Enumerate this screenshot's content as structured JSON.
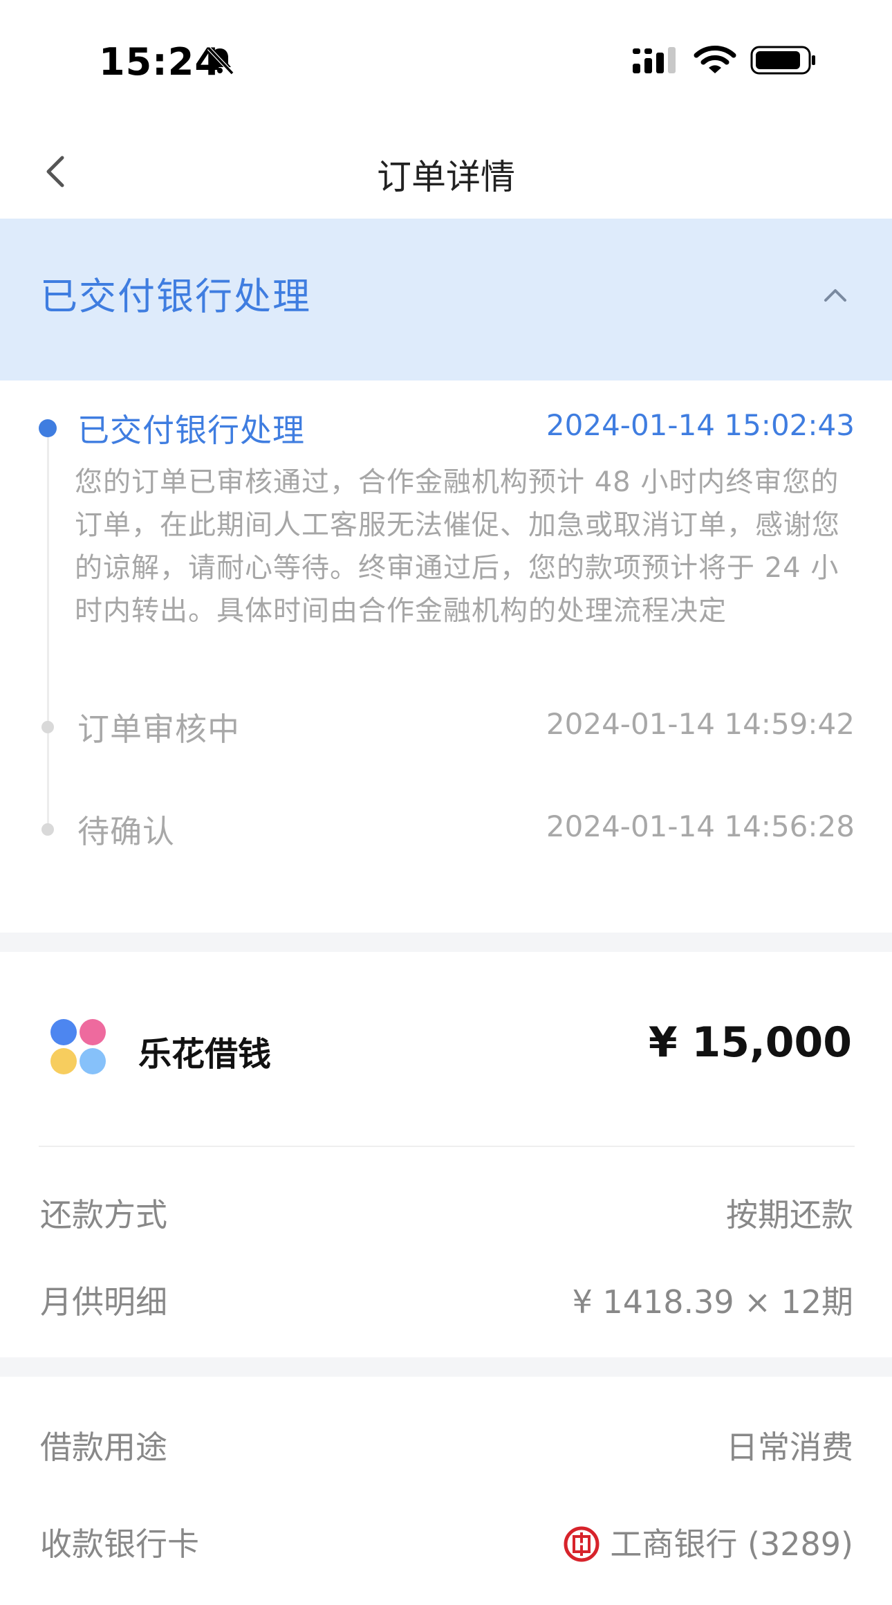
{
  "status_bar": {
    "time": "15:24",
    "icons": [
      "bell-slash-icon",
      "signal-icon",
      "wifi-icon",
      "battery-icon"
    ]
  },
  "nav": {
    "title": "订单详情",
    "back_icon": "chevron-left-icon"
  },
  "banner": {
    "title": "已交付银行处理",
    "toggle_icon": "chevron-up-icon"
  },
  "timeline": [
    {
      "label": "已交付银行处理",
      "time": "2024-01-14 15:02:43",
      "description": "您的订单已审核通过，合作金融机构预计 48 小时内终审您的订单，在此期间人工客服无法催促、加急或取消订单，感谢您的谅解，请耐心等待。终审通过后，您的款项预计将于 24 小时内转出。具体时间由合作金融机构的处理流程决定"
    },
    {
      "label": "订单审核中",
      "time": "2024-01-14 14:59:42"
    },
    {
      "label": "待确认",
      "time": "2024-01-14 14:56:28"
    }
  ],
  "loan": {
    "product_name": "乐花借钱",
    "amount": "¥ 15,000",
    "rows": [
      {
        "label": "还款方式",
        "value": "按期还款"
      },
      {
        "label": "月供明细",
        "value": "¥ 1418.39 × 12期"
      }
    ]
  },
  "details": [
    {
      "label": "借款用途",
      "value": "日常消费"
    },
    {
      "label": "收款银行卡",
      "value": "工商银行 (3289)",
      "icon": "icbc-bank-icon"
    }
  ],
  "colors": {
    "accent": "#3f7de0",
    "banner_bg": "#deebfb",
    "muted": "#a8a8a8",
    "separator": "#f4f5f7"
  }
}
